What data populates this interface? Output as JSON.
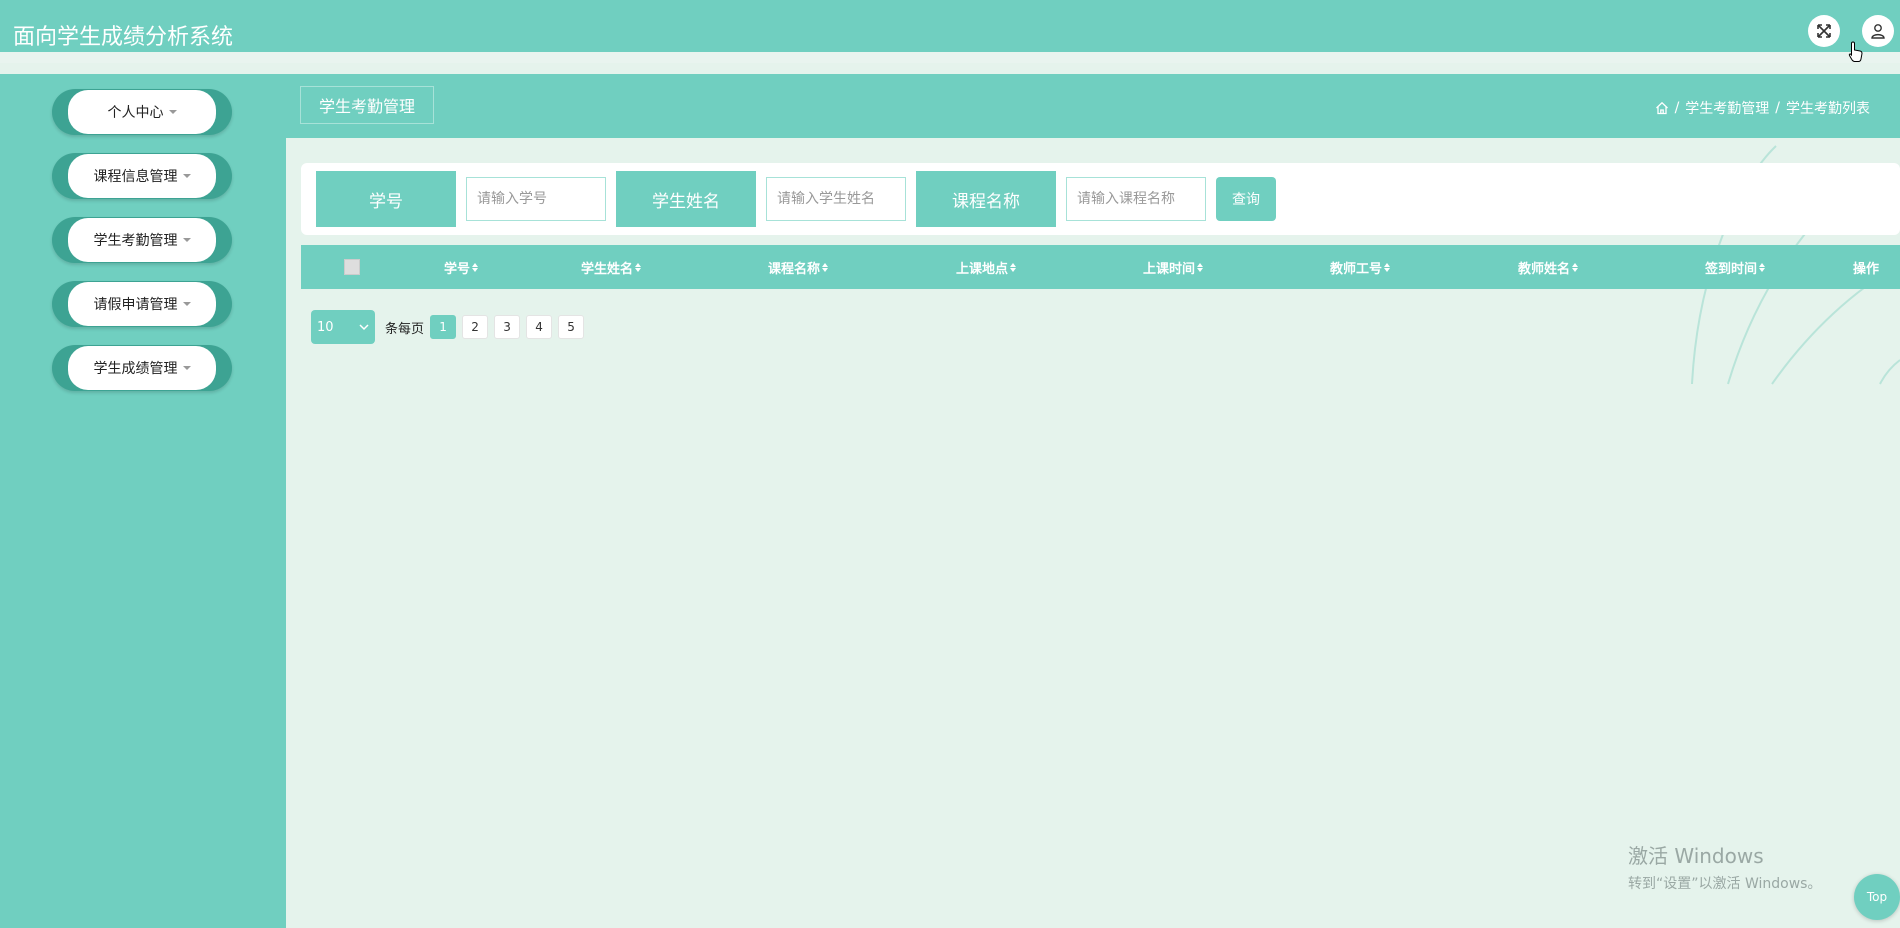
{
  "app": {
    "title": "面向学生成绩分析系统"
  },
  "topbar": {
    "fullscreen_icon": "fullscreen-icon",
    "user_icon": "user-icon"
  },
  "sidebar": {
    "items": [
      {
        "label": "个人中心"
      },
      {
        "label": "课程信息管理"
      },
      {
        "label": "学生考勤管理"
      },
      {
        "label": "请假申请管理"
      },
      {
        "label": "学生成绩管理"
      }
    ]
  },
  "page": {
    "title": "学生考勤管理",
    "breadcrumb": [
      "学生考勤管理",
      "学生考勤列表"
    ],
    "breadcrumb_separator": "/"
  },
  "search": {
    "fields": [
      {
        "label": "学号",
        "placeholder": "请输入学号"
      },
      {
        "label": "学生姓名",
        "placeholder": "请输入学生姓名"
      },
      {
        "label": "课程名称",
        "placeholder": "请输入课程名称"
      }
    ],
    "button": "查询"
  },
  "table": {
    "columns": [
      "学号",
      "学生姓名",
      "课程名称",
      "上课地点",
      "上课时间",
      "教师工号",
      "教师姓名",
      "签到时间",
      "操作"
    ],
    "rows": []
  },
  "pagination": {
    "page_size": "10",
    "per_page_label": "条每页",
    "pages": [
      "1",
      "2",
      "3",
      "4",
      "5"
    ],
    "current": "1"
  },
  "watermark": {
    "line1": "激活 Windows",
    "line2": "转到“设置”以激活 Windows。"
  },
  "back_to_top": "Top",
  "colors": {
    "primary": "#70cfc0",
    "menu_pill": "#3da393",
    "background": "#e5f3ec"
  }
}
